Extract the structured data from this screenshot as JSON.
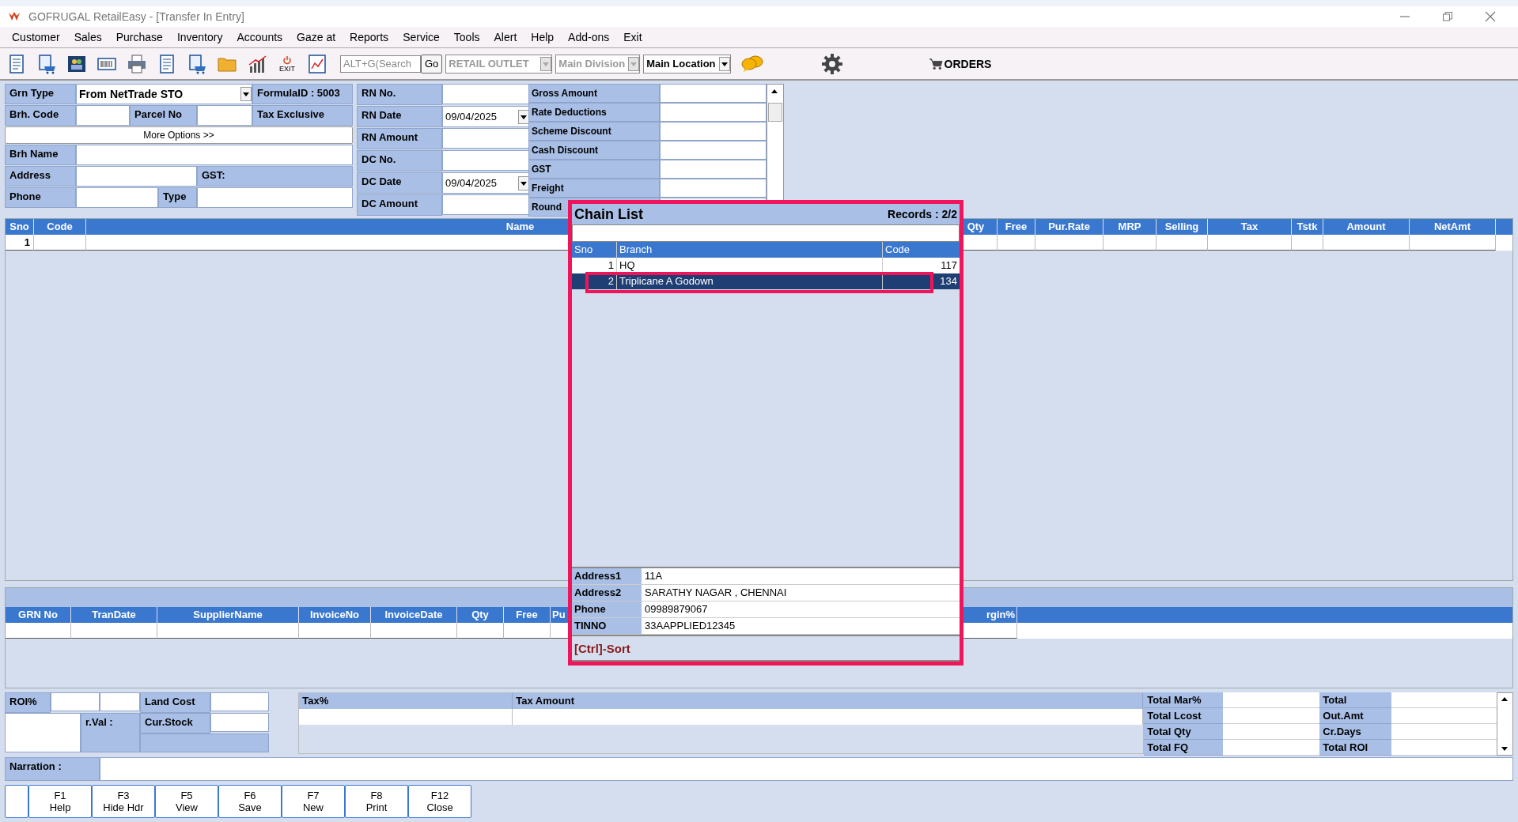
{
  "window": {
    "title": "GOFRUGAL RetailEasy - [Transfer In Entry]"
  },
  "menu": [
    "Customer",
    "Sales",
    "Purchase",
    "Inventory",
    "Accounts",
    "Gaze at",
    "Reports",
    "Service",
    "Tools",
    "Alert",
    "Help",
    "Add-ons",
    "Exit"
  ],
  "toolbar": {
    "exit_label": "EXIT",
    "search": {
      "placeholder": "ALT+G(Search"
    },
    "go_button": "Go",
    "dropdowns": [
      {
        "value": "RETAIL OUTLET",
        "disabled": true
      },
      {
        "value": "Main Division",
        "disabled": true
      },
      {
        "value": "Main Location",
        "disabled": false
      }
    ],
    "orders_button": "ORDERS"
  },
  "transfer_form": {
    "grn_type_label": "Grn Type",
    "grn_type_value": "From NetTrade STO",
    "formula_id": "FormulaID : 5003",
    "brh_code_label": "Brh. Code",
    "parcel_no_label": "Parcel No",
    "tax_mode": "Tax Exclusive",
    "more_options_button": "More Options >>",
    "brh_name_label": "Brh Name",
    "address_label": "Address",
    "gst_label": "GST:",
    "phone_label": "Phone",
    "type_label": "Type"
  },
  "document_fields": [
    {
      "label": "RN No."
    },
    {
      "label": "RN Date",
      "date": "09/04/2025"
    },
    {
      "label": "RN Amount"
    },
    {
      "label": "DC No."
    },
    {
      "label": "DC Date",
      "date": "09/04/2025"
    },
    {
      "label": "DC Amount"
    }
  ],
  "summary": [
    "Gross Amount",
    "Rate Deductions",
    "Scheme Discount",
    "Cash Discount",
    "GST",
    "Freight",
    "Round"
  ],
  "items_grid": {
    "columns": [
      "Sno",
      "Code",
      "Name",
      "Qty",
      "Free",
      "Pur.Rate",
      "MRP",
      "Selling",
      "Tax",
      "Tstk",
      "Amount",
      "NetAmt"
    ],
    "rows": [
      {
        "sno": "1"
      }
    ]
  },
  "chain_list": {
    "title": "Chain List",
    "records": "Records : 2/2",
    "columns": [
      "Sno",
      "Branch",
      "Code"
    ],
    "rows": [
      {
        "sno": "1",
        "branch": "HQ",
        "code": "117",
        "selected": false
      },
      {
        "sno": "2",
        "branch": "Triplicane A Godown",
        "code": "134",
        "selected": true
      }
    ],
    "details": [
      {
        "label": "Address1",
        "value": "11A"
      },
      {
        "label": "Address2",
        "value": "SARATHY NAGAR , CHENNAI"
      },
      {
        "label": "Phone",
        "value": "09989879067"
      },
      {
        "label": "TINNO",
        "value": "33AAPPLIED12345"
      }
    ],
    "sort_hint": "[Ctrl]-Sort"
  },
  "history_grid": {
    "columns": [
      "GRN No",
      "TranDate",
      "SupplierName",
      "InvoiceNo",
      "InvoiceDate",
      "Qty",
      "Free",
      "Pu",
      "rgin%"
    ]
  },
  "bottom": {
    "roi_label": "ROI%",
    "land_cost_label": "Land Cost",
    "val_label": "r.Val :",
    "cur_stock_label": "Cur.Stock",
    "tax_columns": [
      "Tax%",
      "Tax Amount"
    ],
    "totals": [
      {
        "left": "Total Mar%",
        "right": "Total"
      },
      {
        "left": "Total Lcost",
        "right": "Out.Amt"
      },
      {
        "left": "Total Qty",
        "right": "Cr.Days"
      },
      {
        "left": "Total FQ",
        "right": "Total ROI"
      }
    ],
    "narration_label": "Narration :"
  },
  "function_keys": [
    {
      "key": "F1",
      "label": "Help"
    },
    {
      "key": "F3",
      "label": "Hide Hdr"
    },
    {
      "key": "F5",
      "label": "View"
    },
    {
      "key": "F6",
      "label": "Save"
    },
    {
      "key": "F7",
      "label": "New"
    },
    {
      "key": "F8",
      "label": "Print"
    },
    {
      "key": "F12",
      "label": "Close"
    }
  ]
}
